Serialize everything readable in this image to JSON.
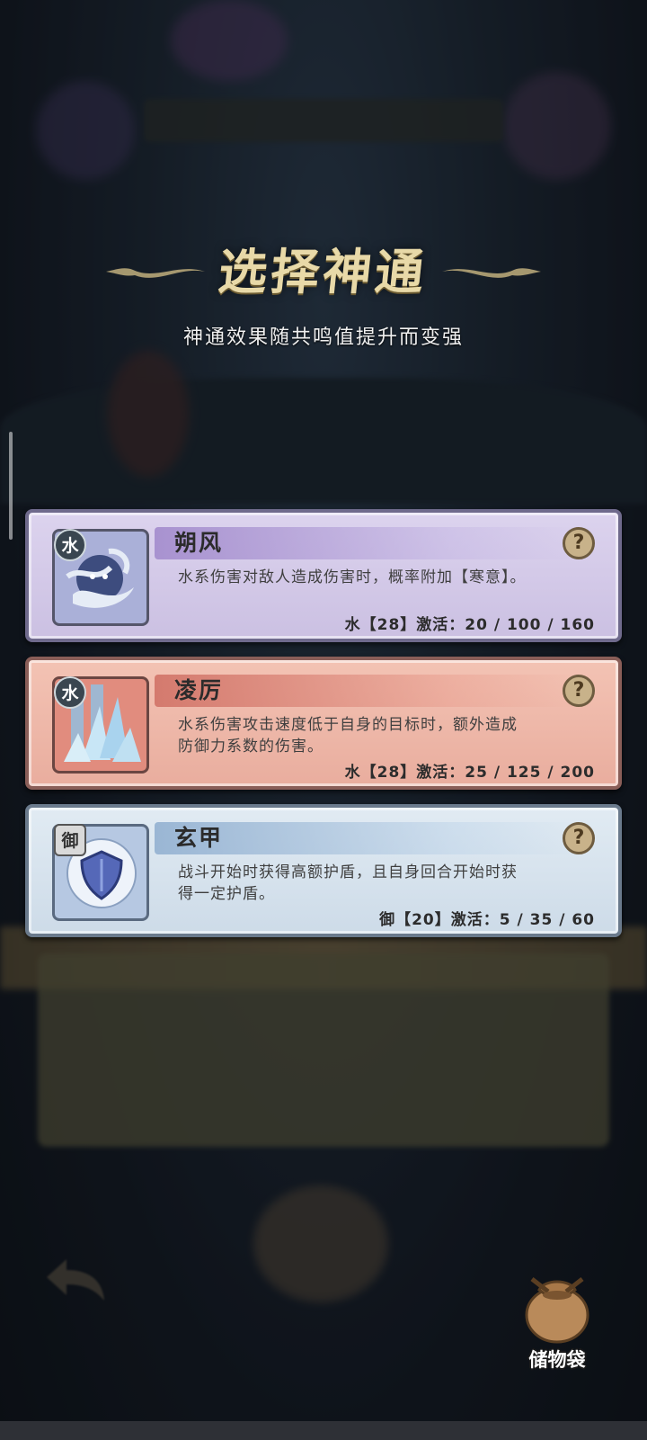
{
  "title": "选择神通",
  "subtitle": "神通效果随共鸣值提升而变强",
  "cards": [
    {
      "theme": "purple",
      "element": "水",
      "name": "朔风",
      "description": "水系伤害对敌人造成伤害时，概率附加【寒意】。",
      "stats": "水【28】激活：20 / 100 / 160",
      "icon": "wind-spirit-icon"
    },
    {
      "theme": "red",
      "element": "水",
      "name": "凌厉",
      "description": "水系伤害攻击速度低于自身的目标时，额外造成防御力系数的伤害。",
      "stats": "水【28】激活：25 / 125 / 200",
      "icon": "ice-crystal-icon"
    },
    {
      "theme": "blue",
      "element": "御",
      "name": "玄甲",
      "description": "战斗开始时获得高额护盾，且自身回合开始时获得一定护盾。",
      "stats": "御【20】激活：5 / 35 / 60",
      "icon": "shield-icon"
    }
  ],
  "help_label": "?",
  "storage_bag": {
    "label": "储物袋",
    "icon": "bag-icon"
  },
  "colors": {
    "title": "#e8d9a8",
    "card_purple": "#cbc0e2",
    "card_red": "#e9ad9e",
    "card_blue": "#cddbe8"
  }
}
